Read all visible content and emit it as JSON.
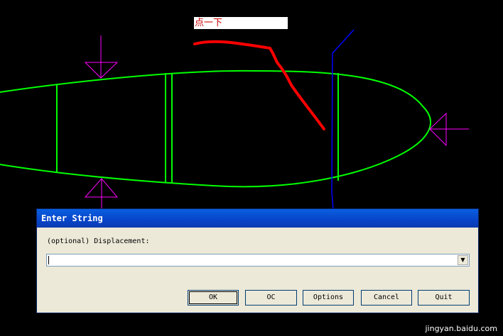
{
  "annotation": {
    "text": "点一下"
  },
  "dialog": {
    "title": "Enter String",
    "prompt_label": "(optional) Displacement:",
    "input_value": "",
    "buttons": {
      "ok": "OK",
      "oc": "OC",
      "options": "Options",
      "cancel": "Cancel",
      "quit": "Quit"
    }
  },
  "watermark": "jingyan.baidu.com",
  "colors": {
    "background": "#000000",
    "geometry": "#00FF00",
    "arrows": "#FF00FF",
    "axis": "#0000FF",
    "annotation_stroke": "#FF0000"
  }
}
